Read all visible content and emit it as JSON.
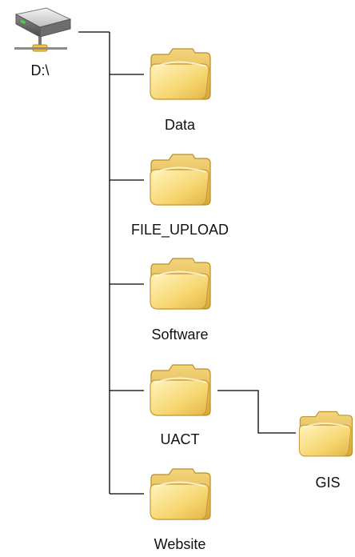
{
  "tree": {
    "root": {
      "label": "D:\\",
      "icon": "network-drive-icon"
    },
    "children": [
      {
        "label": "Data",
        "icon": "folder-icon"
      },
      {
        "label": "FILE_UPLOAD",
        "icon": "folder-icon"
      },
      {
        "label": "Software",
        "icon": "folder-icon"
      },
      {
        "label": "UACT",
        "icon": "folder-icon",
        "children": [
          {
            "label": "GIS",
            "icon": "folder-icon"
          }
        ]
      },
      {
        "label": "Website",
        "icon": "folder-icon"
      }
    ]
  }
}
